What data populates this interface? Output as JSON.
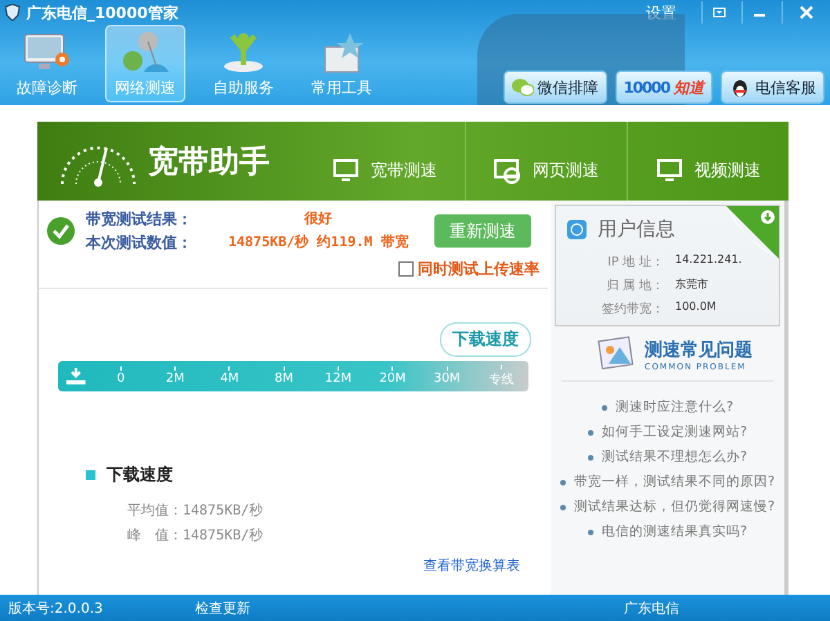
{
  "window": {
    "title": "广东电信_10000管家",
    "settings": "设置"
  },
  "nav_tabs": [
    {
      "label": "故障诊断",
      "selected": false
    },
    {
      "label": "网络测速",
      "selected": true
    },
    {
      "label": "自助服务",
      "selected": false
    },
    {
      "label": "常用工具",
      "selected": false
    }
  ],
  "quick_buttons": [
    {
      "kind": "wechat",
      "label": "微信排障"
    },
    {
      "kind": "zhidao",
      "number": "10000",
      "label": "知道"
    },
    {
      "kind": "service",
      "label": "电信客服"
    }
  ],
  "banner": {
    "title": "宽带助手",
    "tabs": [
      "宽带测速",
      "网页测速",
      "视频测速"
    ]
  },
  "result": {
    "rows": [
      {
        "label": "带宽测试结果：",
        "value": "很好"
      },
      {
        "label": "本次测试数值：",
        "value": "14875KB/秒 约119.M 带宽"
      }
    ],
    "retest_button": "重新测速",
    "upload_checkbox": {
      "label": "同时测试上传速率",
      "checked": false
    }
  },
  "speed_scale": {
    "bubble": "下载速度",
    "ticks": [
      "0",
      "2M",
      "4M",
      "8M",
      "12M",
      "20M",
      "30M",
      "专线"
    ]
  },
  "download_stats": {
    "title": "下载速度",
    "average": "平均值：14875KB/秒",
    "peak": "峰　值：14875KB/秒",
    "link": "查看带宽换算表"
  },
  "user_info": {
    "title": "用户信息",
    "rows": [
      {
        "label": "IP 地 址：",
        "value": "14.221.241."
      },
      {
        "label": "归 属 地：",
        "value": "东莞市"
      },
      {
        "label": "签约带宽：",
        "value": "100.0M"
      }
    ]
  },
  "faq": {
    "title": "测速常见问题",
    "subtitle": "COMMON PROBLEM",
    "items": [
      "测速时应注意什么?",
      "如何手工设定测速网站?",
      "测试结果不理想怎么办?",
      "带宽一样，测试结果不同的原因?",
      "测试结果达标，但仍觉得网速慢?",
      "电信的测速结果真实吗?"
    ]
  },
  "status_bar": {
    "version": "版本号:2.0.0.3",
    "update": "检查更新",
    "carrier": "广东电信"
  }
}
